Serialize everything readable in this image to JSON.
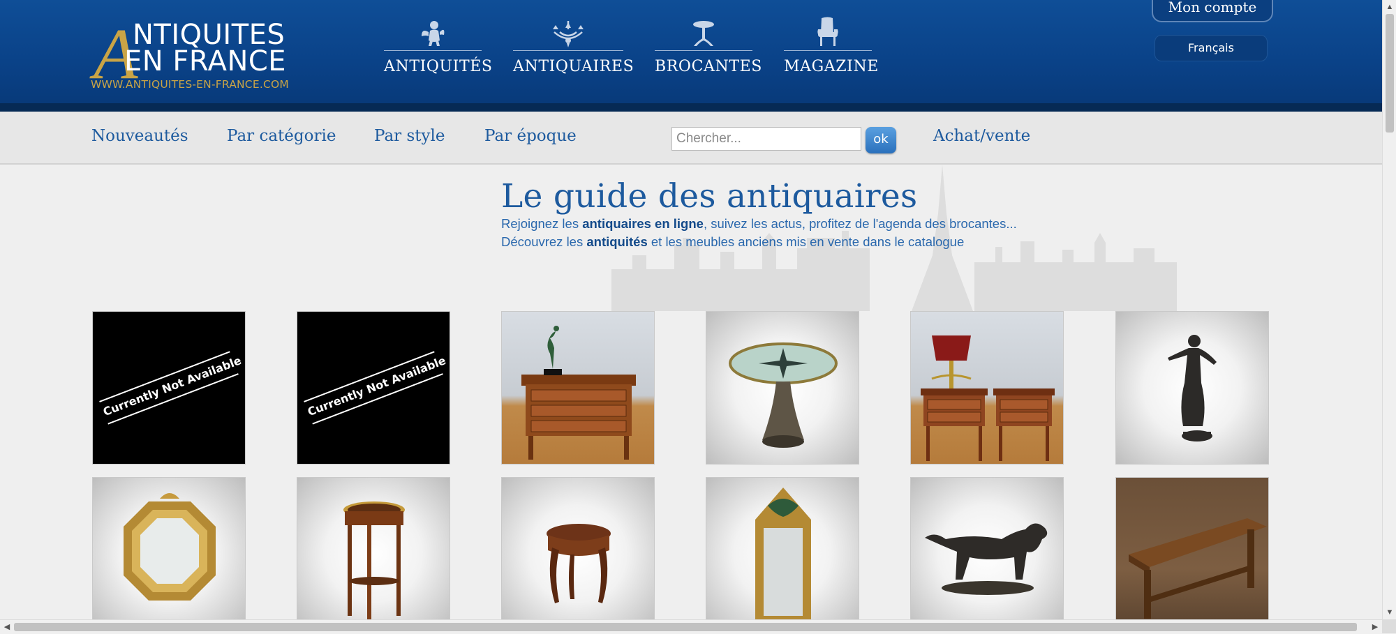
{
  "logo": {
    "line1": "NTIQUITES",
    "line2": "EN FRANCE",
    "letter": "A",
    "url": "WWW.ANTIQUITES-EN-FRANCE.COM"
  },
  "mainnav": [
    {
      "label": "ANTIQUITÉS",
      "icon": "cherub-icon"
    },
    {
      "label": "ANTIQUAIRES",
      "icon": "chandelier-icon"
    },
    {
      "label": "BROCANTES",
      "icon": "pedestal-table-icon"
    },
    {
      "label": "MAGAZINE",
      "icon": "armchair-icon"
    }
  ],
  "account": {
    "label": "Mon compte"
  },
  "language": {
    "label": "Français"
  },
  "subnav": {
    "links": [
      "Nouveautés",
      "Par catégorie",
      "Par style",
      "Par époque"
    ],
    "search_placeholder": "Chercher...",
    "ok_label": "ok",
    "achat_label": "Achat/vente"
  },
  "hero": {
    "title": "Le guide des antiquaires",
    "line1_pre": "Rejoignez les ",
    "line1_bold": "antiquaires en ligne",
    "line1_post": ", suivez les actus, profitez de l'agenda des brocantes...",
    "line2_pre": "Découvrez les ",
    "line2_bold": "antiquités",
    "line2_post": " et les meubles anciens mis en vente dans le catalogue"
  },
  "products": [
    {
      "name": "not-available-1",
      "status": "Currently Not Available"
    },
    {
      "name": "not-available-2",
      "status": "Currently Not Available"
    },
    {
      "name": "commode-bronze-dancer"
    },
    {
      "name": "compass-rose-pedestal-table"
    },
    {
      "name": "pair-bedside-tables-bouillotte-lamp"
    },
    {
      "name": "bronze-woman-statue"
    },
    {
      "name": "octagonal-gilt-mirror"
    },
    {
      "name": "round-gueridon-table"
    },
    {
      "name": "louis-xv-side-table"
    },
    {
      "name": "gilt-wall-mirror"
    },
    {
      "name": "bronze-dog-sculpture"
    },
    {
      "name": "farmhouse-wooden-table"
    }
  ],
  "colors": {
    "header_blue": "#0b4a92",
    "link_blue": "#1d5a9e",
    "gold": "#c9a446"
  }
}
